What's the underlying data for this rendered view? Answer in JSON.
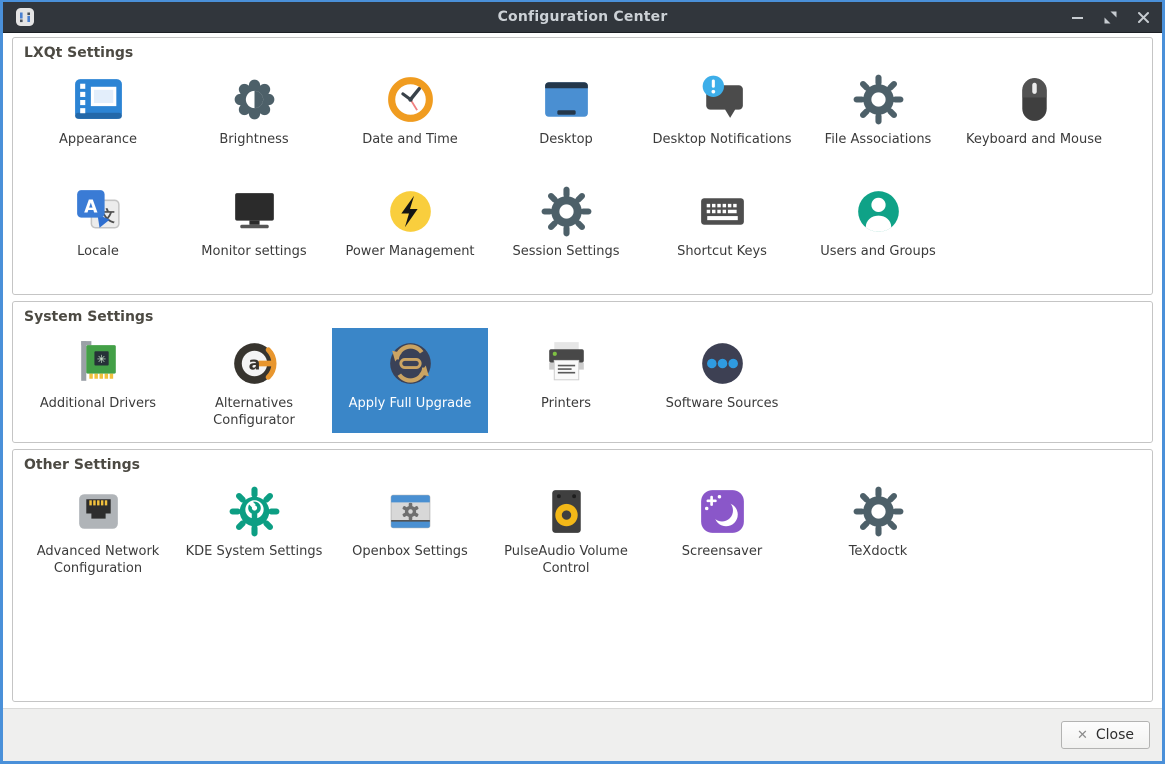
{
  "window": {
    "title": "Configuration Center"
  },
  "colors": {
    "titlebar_bg": "#31363c",
    "window_border": "#4a90d9",
    "selection_bg": "#3a86c8",
    "footer_bg": "#efefee"
  },
  "sections": [
    {
      "label": "LXQt Settings",
      "items": [
        {
          "label": "Appearance",
          "icon": "appearance"
        },
        {
          "label": "Brightness",
          "icon": "brightness"
        },
        {
          "label": "Date and Time",
          "icon": "date-time"
        },
        {
          "label": "Desktop",
          "icon": "desktop"
        },
        {
          "label": "Desktop Notifications",
          "icon": "desktop-notifications"
        },
        {
          "label": "File Associations",
          "icon": "file-associations"
        },
        {
          "label": "Keyboard and Mouse",
          "icon": "keyboard-mouse"
        },
        {
          "label": "Locale",
          "icon": "locale"
        },
        {
          "label": "Monitor settings",
          "icon": "monitor-settings"
        },
        {
          "label": "Power Management",
          "icon": "power-management"
        },
        {
          "label": "Session Settings",
          "icon": "session-settings"
        },
        {
          "label": "Shortcut Keys",
          "icon": "shortcut-keys"
        },
        {
          "label": "Users and Groups",
          "icon": "users-groups"
        }
      ]
    },
    {
      "label": "System Settings",
      "items": [
        {
          "label": "Additional Drivers",
          "icon": "additional-drivers"
        },
        {
          "label": "Alternatives Configurator",
          "icon": "alternatives-configurator"
        },
        {
          "label": "Apply Full Upgrade",
          "icon": "apply-full-upgrade",
          "selected": true
        },
        {
          "label": "Printers",
          "icon": "printers"
        },
        {
          "label": "Software Sources",
          "icon": "software-sources"
        }
      ]
    },
    {
      "label": "Other Settings",
      "items": [
        {
          "label": "Advanced Network Configuration",
          "icon": "advanced-network"
        },
        {
          "label": "KDE System Settings",
          "icon": "kde-system-settings"
        },
        {
          "label": "Openbox Settings",
          "icon": "openbox-settings"
        },
        {
          "label": "PulseAudio Volume Control",
          "icon": "pulseaudio-volume"
        },
        {
          "label": "Screensaver",
          "icon": "screensaver"
        },
        {
          "label": "TeXdoctk",
          "icon": "texdoctk"
        }
      ]
    }
  ],
  "titlebar_controls": [
    {
      "name": "minimize"
    },
    {
      "name": "maximize"
    },
    {
      "name": "close"
    }
  ],
  "footer": {
    "close_label": "Close",
    "close_icon": "✕"
  }
}
